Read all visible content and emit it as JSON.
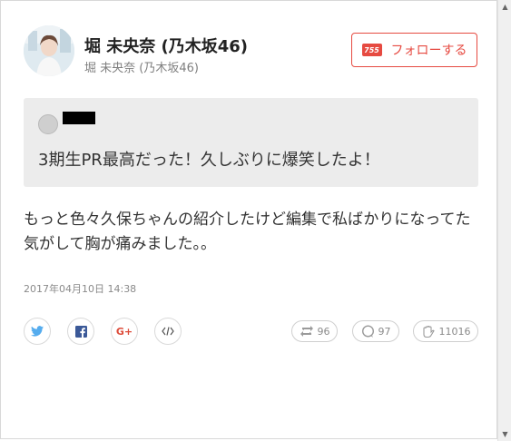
{
  "profile": {
    "name": "堀 未央奈 (乃木坂46)",
    "subname": "堀 未央奈 (乃木坂46)",
    "follow_label": "フォローする",
    "follow_logo": "755"
  },
  "quote": {
    "text": "3期生PR最高だった！久しぶりに爆笑したよ！"
  },
  "post": {
    "body": "もっと色々久保ちゃんの紹介したけど編集で私ばかりになってた気がして胸が痛みました。。",
    "timestamp": "2017年04月10日 14:38"
  },
  "share": {
    "google_plus_label": "G+"
  },
  "stats": {
    "reposts": "96",
    "comments": "97",
    "claps": "11016"
  },
  "colors": {
    "accent": "#e64a41",
    "twitter": "#55acee",
    "facebook": "#3b5998",
    "google": "#dd4b39"
  }
}
